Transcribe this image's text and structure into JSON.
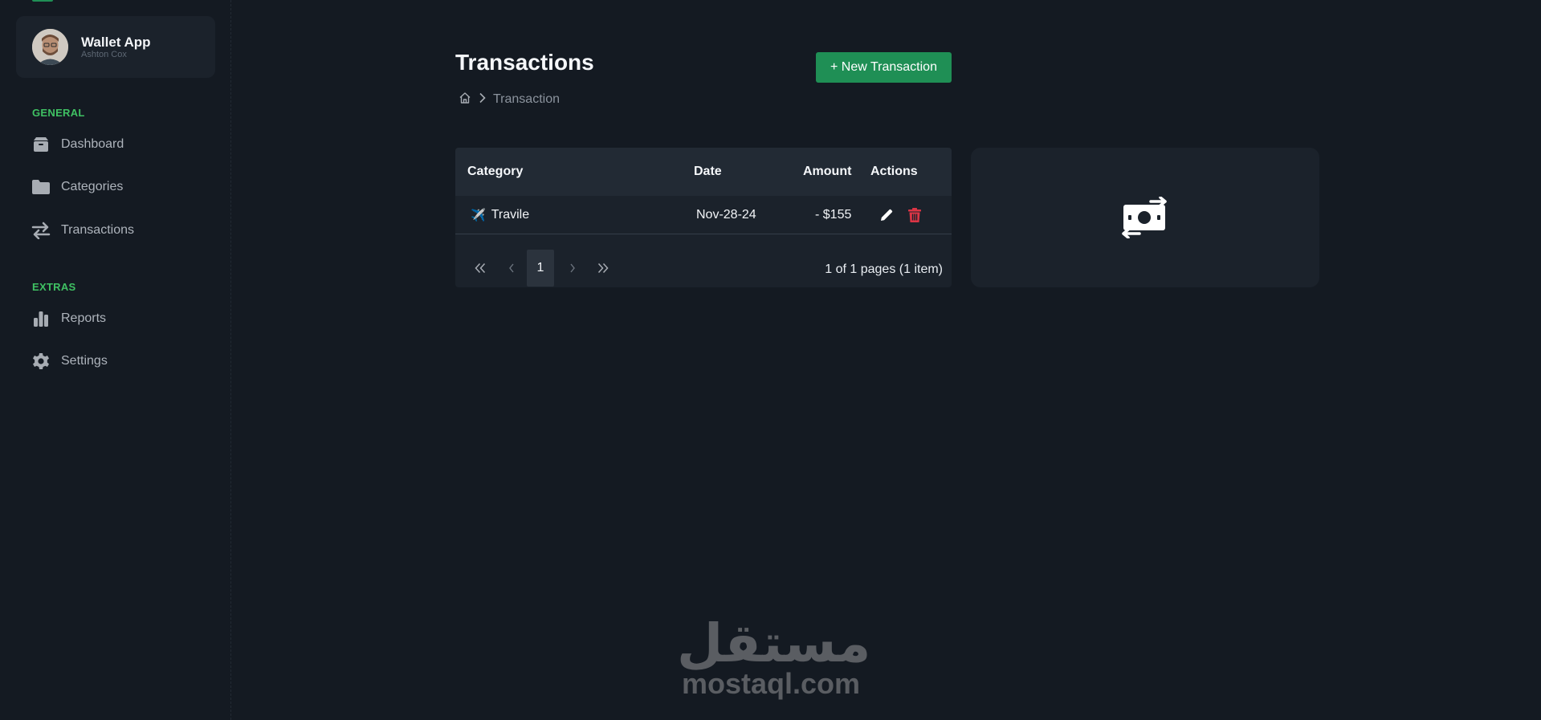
{
  "sidebar": {
    "app_name": "Wallet App",
    "user_name": "Ashton Cox",
    "sections": [
      {
        "label": "GENERAL"
      },
      {
        "label": "EXTRAS"
      }
    ],
    "items": [
      {
        "label": "Dashboard",
        "icon": "box-icon"
      },
      {
        "label": "Categories",
        "icon": "folder-icon"
      },
      {
        "label": "Transactions",
        "icon": "arrows-exchange-icon"
      },
      {
        "label": "Reports",
        "icon": "bar-chart-icon"
      },
      {
        "label": "Settings",
        "icon": "gear-icon"
      }
    ]
  },
  "header": {
    "title": "Transactions",
    "new_button_label": "+ New Transaction"
  },
  "breadcrumb": {
    "current": "Transaction"
  },
  "table": {
    "columns": [
      "Category",
      "Date",
      "Amount",
      "Actions"
    ],
    "rows": [
      {
        "category_icon": "✈️",
        "category": "Travile",
        "date": "Nov-28-24",
        "amount": "- $155"
      }
    ]
  },
  "pagination": {
    "current_page": "1",
    "info": "1 of 1 pages (1 item)"
  },
  "watermark": {
    "arabic": "مستقل",
    "latin": "mostaql.com"
  },
  "colors": {
    "accent": "#1f8f55",
    "section_label": "#3fc163",
    "delete": "#dc3545",
    "background": "#141a22",
    "card": "#1b222b"
  }
}
